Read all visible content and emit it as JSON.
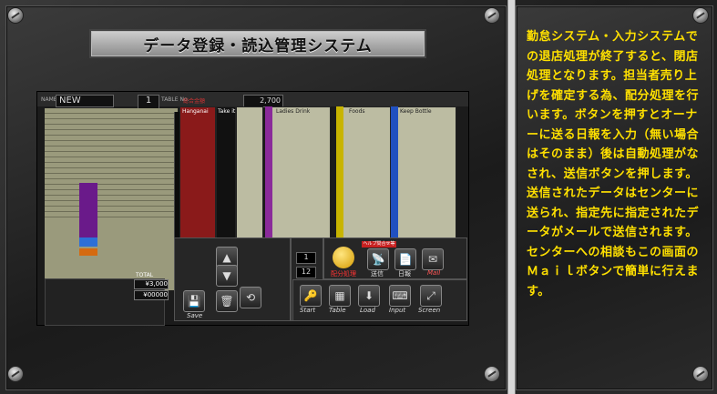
{
  "title": "データ登録・読込管理システム",
  "description": "勤怠システム・入力システムでの退店処理が終了すると、閉店処理となります。担当者売り上げを確定する為、配分処理を行います。ボタンを押すとオーナーに送る日報を入力（無い場合はそのまま）後は自動処理がなされ、送信ボタンを押します。送信されたデータはセンターに送られ、指定先に指定されたデータがメールで送信されます。センターへの相談もこの画面のＭａｉｌボタンで簡単に行えます。",
  "app": {
    "name_label": "NAME",
    "name_value": "NEW",
    "table_no": "1",
    "table_no_label": "TABLE No.",
    "amount_label": "総合金額",
    "amount_value": "2,700",
    "big_count": "1",
    "total_label": "TOTAL",
    "total_value": "¥3,000",
    "sub_total_value": "¥00000",
    "columns": {
      "c1": "Hanganai",
      "c2": "Take it",
      "c3": "Ladies Drink",
      "c4": "Foods",
      "c5": "Keep Bottle"
    },
    "controls": {
      "save": "Save",
      "start": "Start",
      "table": "Table",
      "load": "Load",
      "input": "Input",
      "screen": "Screen",
      "haibun": "配分処理",
      "send": "送信",
      "report": "日報",
      "mail": "Mail",
      "badge": "ヘルプ問合せ等",
      "disp_a": "1",
      "disp_b": "12"
    }
  }
}
